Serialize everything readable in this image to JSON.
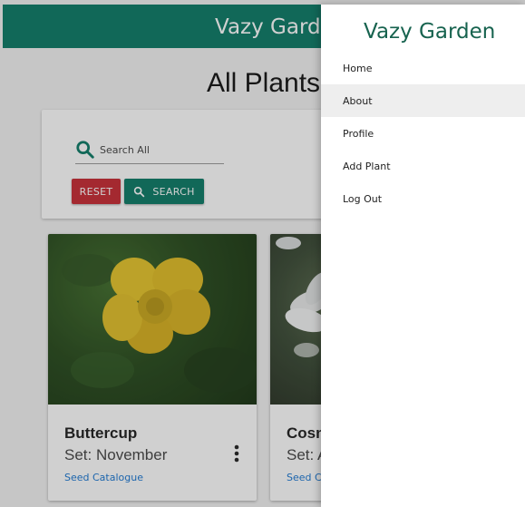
{
  "app": {
    "title": "Vazy Garden"
  },
  "page": {
    "title": "All Plants"
  },
  "search": {
    "placeholder": "Search All",
    "reset_label": "RESET",
    "search_label": "SEARCH"
  },
  "cards": [
    {
      "name": "Buttercup",
      "set": "Set: November",
      "link": "Seed Catalogue"
    },
    {
      "name": "Cosm",
      "set": "Set: A",
      "link": "Seed Ca"
    }
  ],
  "drawer": {
    "title": "Vazy Garden",
    "items": [
      {
        "label": "Home",
        "active": false
      },
      {
        "label": "About",
        "active": true
      },
      {
        "label": "Profile",
        "active": false
      },
      {
        "label": "Add Plant",
        "active": false
      },
      {
        "label": "Log Out",
        "active": false
      }
    ]
  },
  "colors": {
    "primary": "#0b7a66",
    "danger": "#c72a33",
    "drawer_title": "#17634f"
  },
  "icons": {
    "search": "search-icon",
    "more": "more-vert-icon"
  }
}
